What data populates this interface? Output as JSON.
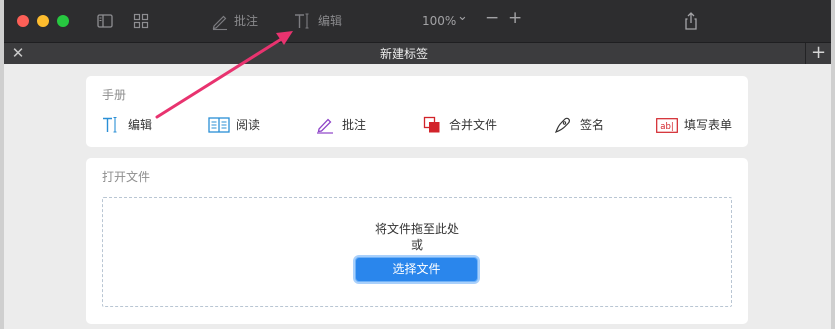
{
  "toolbar": {
    "annotate_label": "批注",
    "edit_label": "编辑",
    "zoom_value": "100%",
    "zoom_dropdown_glyph": "⌄",
    "zoom_out_glyph": "−",
    "zoom_in_glyph": "+"
  },
  "tab": {
    "title": "新建标签",
    "close_glyph": "✕",
    "add_glyph": "+"
  },
  "manual": {
    "title": "手册",
    "actions": [
      {
        "label": "编辑",
        "icon": "edit-text-icon"
      },
      {
        "label": "阅读",
        "icon": "book-icon"
      },
      {
        "label": "批注",
        "icon": "pen-icon"
      },
      {
        "label": "合并文件",
        "icon": "merge-icon"
      },
      {
        "label": "签名",
        "icon": "signature-icon"
      },
      {
        "label": "填写表单",
        "icon": "form-field-icon"
      }
    ]
  },
  "open_file": {
    "title": "打开文件",
    "drop_text": "将文件拖至此处",
    "or_text": "或",
    "choose_button": "选择文件"
  },
  "colors": {
    "titlebar": "#2d2d2f",
    "tabbar": "#3c3c3e",
    "accent_blue": "#2a86ec",
    "annotation_arrow": "#e8336f"
  }
}
